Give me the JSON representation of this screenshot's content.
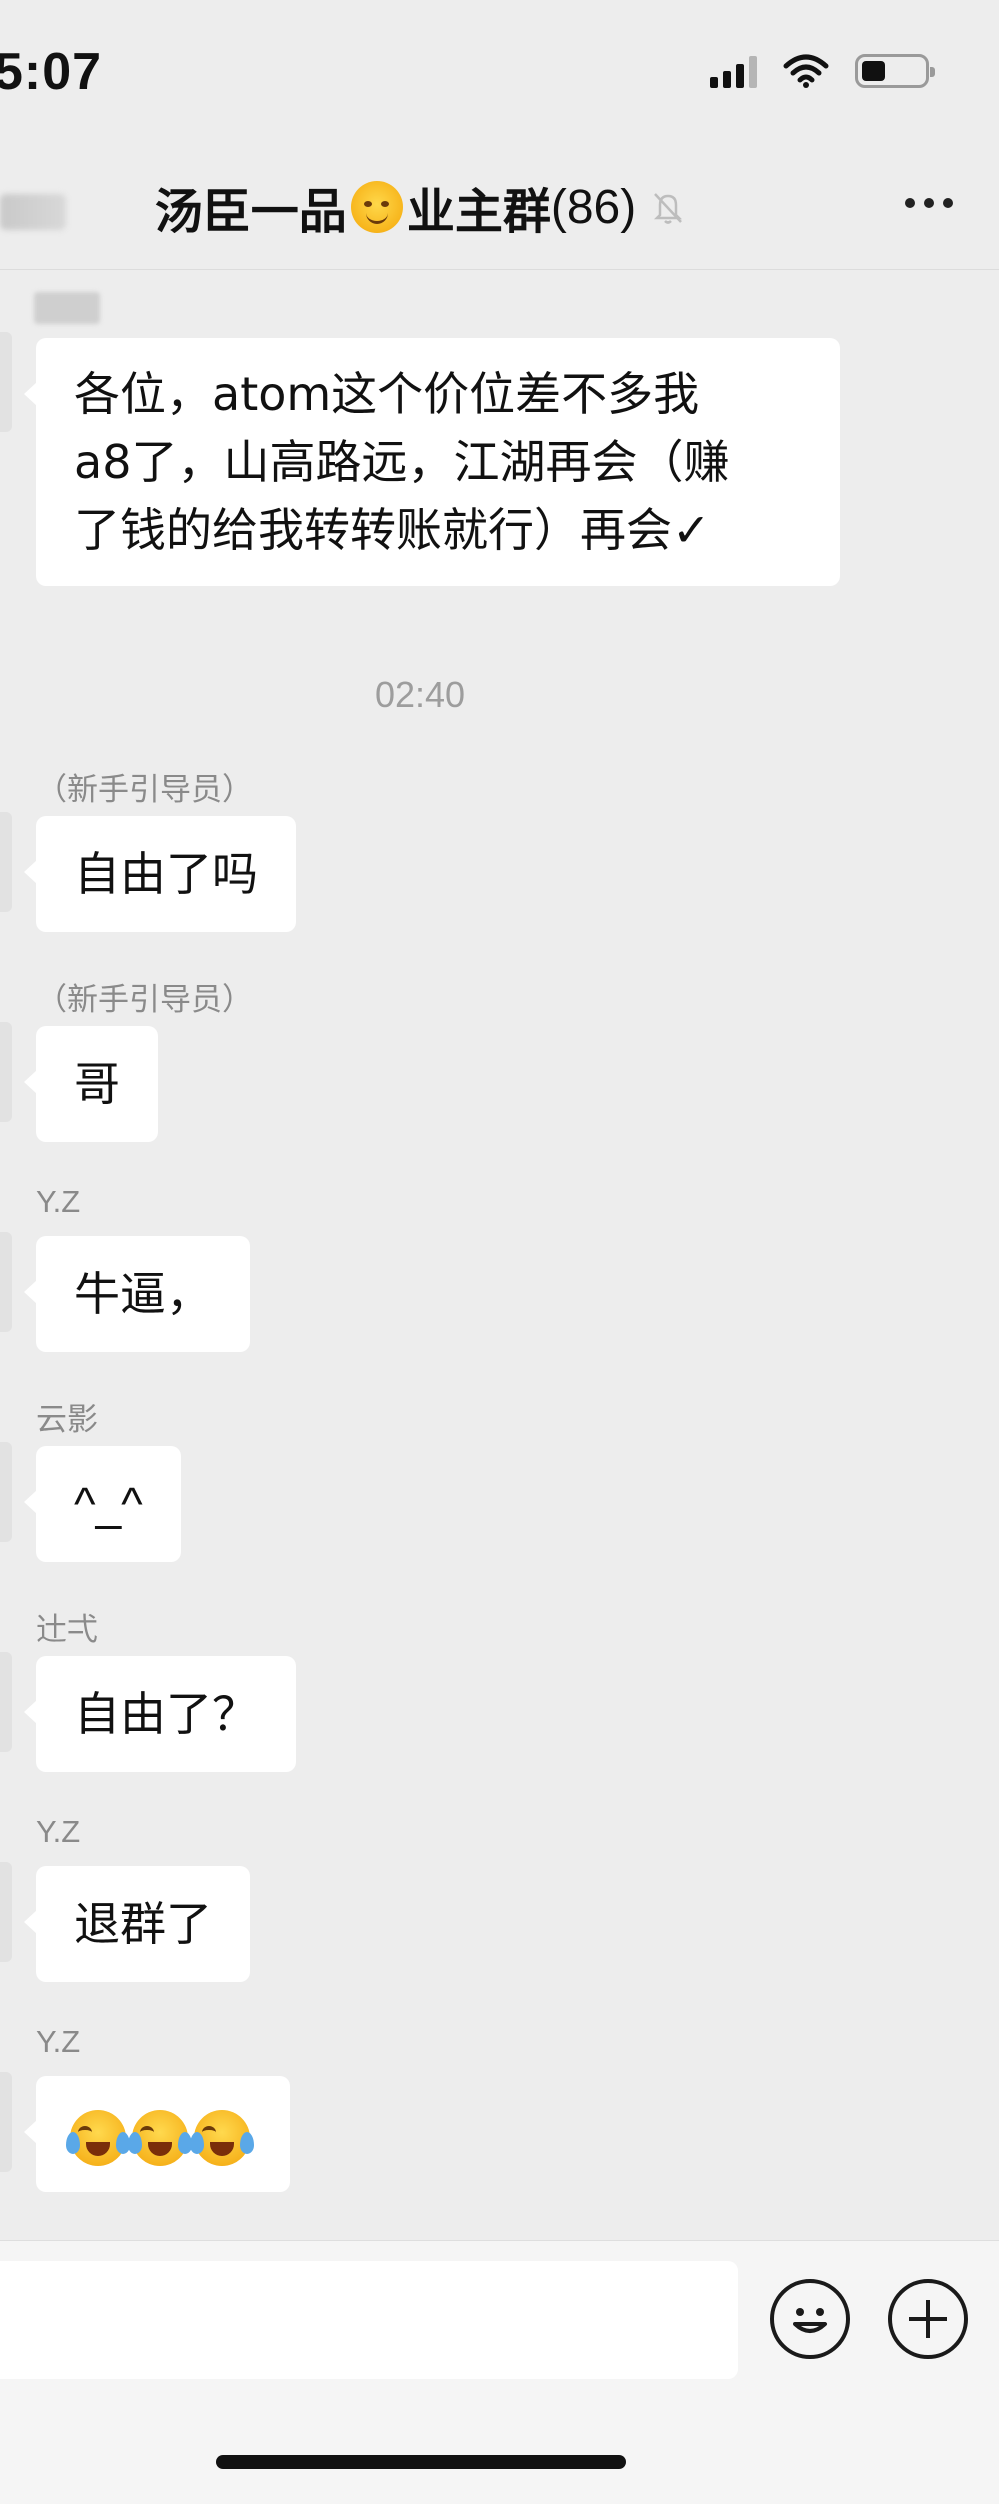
{
  "status_bar": {
    "time": "5:07"
  },
  "nav": {
    "title_prefix": "汤臣一品",
    "title_suffix": "业主群",
    "member_count": "(86)"
  },
  "messages": [
    {
      "sender": "",
      "text_lines": [
        "各位，atom这个价位差不多我",
        "a8了，山高路远，江湖再会（赚",
        "了钱的给我转转账就行）再会✓"
      ]
    },
    {
      "sender": "（新手引导员）",
      "text": "自由了吗"
    },
    {
      "sender": "（新手引导员）",
      "text": "哥"
    },
    {
      "sender": "Y.Z",
      "text": "牛逼，"
    },
    {
      "sender": "云影",
      "text": "^_^"
    },
    {
      "sender": "辻弌",
      "text": "自由了？"
    },
    {
      "sender": "Y.Z",
      "text": "退群了"
    },
    {
      "sender": "Y.Z",
      "emoji": [
        "cry-laugh",
        "cry-laugh",
        "cry-laugh"
      ]
    }
  ],
  "timestamp": "02:40",
  "icons": {
    "signal": "signal-bars-icon",
    "wifi": "wifi-icon",
    "battery": "battery-icon",
    "mute": "bell-muted-icon",
    "more": "more-dots-icon",
    "emoji": "smiley-icon",
    "plus": "plus-circle-icon"
  },
  "battery_level": 0.38
}
